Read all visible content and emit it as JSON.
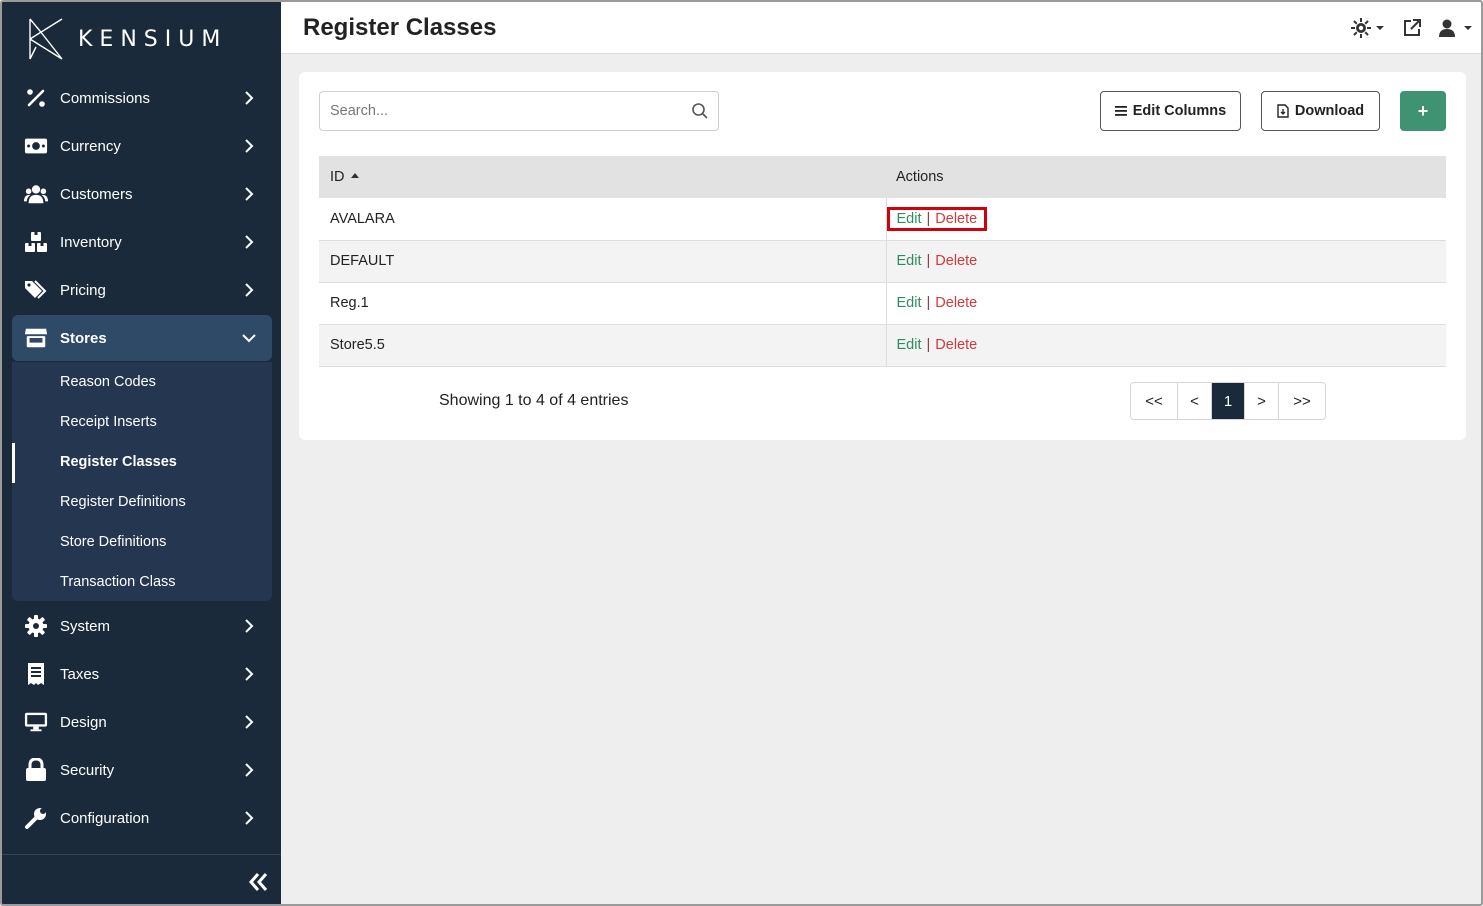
{
  "app": {
    "logo_text": "KENSIUM"
  },
  "header": {
    "title": "Register Classes"
  },
  "sidebar": {
    "items": [
      {
        "label": "Commissions",
        "icon": "percent-icon"
      },
      {
        "label": "Currency",
        "icon": "money-bill-icon"
      },
      {
        "label": "Customers",
        "icon": "users-icon"
      },
      {
        "label": "Inventory",
        "icon": "boxes-icon"
      },
      {
        "label": "Pricing",
        "icon": "tags-icon"
      },
      {
        "label": "Stores",
        "icon": "store-icon",
        "expanded": true
      },
      {
        "label": "System",
        "icon": "gear-icon"
      },
      {
        "label": "Taxes",
        "icon": "receipt-icon"
      },
      {
        "label": "Design",
        "icon": "desktop-icon"
      },
      {
        "label": "Security",
        "icon": "lock-icon"
      },
      {
        "label": "Configuration",
        "icon": "wrench-icon"
      }
    ],
    "stores_sub": [
      {
        "label": "Reason Codes"
      },
      {
        "label": "Receipt Inserts"
      },
      {
        "label": "Register Classes",
        "current": true
      },
      {
        "label": "Register Definitions"
      },
      {
        "label": "Store Definitions"
      },
      {
        "label": "Transaction Class"
      }
    ]
  },
  "toolbar": {
    "search_placeholder": "Search...",
    "edit_columns_label": "Edit Columns",
    "download_label": "Download",
    "add_label": "+"
  },
  "table": {
    "columns": [
      "ID",
      "Actions"
    ],
    "rows": [
      {
        "id": "AVALARA",
        "edit": "Edit",
        "delete": "Delete"
      },
      {
        "id": "DEFAULT",
        "edit": "Edit",
        "delete": "Delete"
      },
      {
        "id": "Reg.1",
        "edit": "Edit",
        "delete": "Delete"
      },
      {
        "id": "Store5.5",
        "edit": "Edit",
        "delete": "Delete"
      }
    ]
  },
  "footer": {
    "showing": "Showing 1 to 4 of 4 entries",
    "pager": [
      "<<",
      "<",
      "1",
      ">",
      ">>"
    ]
  },
  "colors": {
    "sidebar_bg": "#1b2a3a",
    "accent_green": "#3f9272",
    "edit_color": "#2e8b5f",
    "delete_color": "#d23a3a",
    "highlight_box": "#d0000c"
  }
}
